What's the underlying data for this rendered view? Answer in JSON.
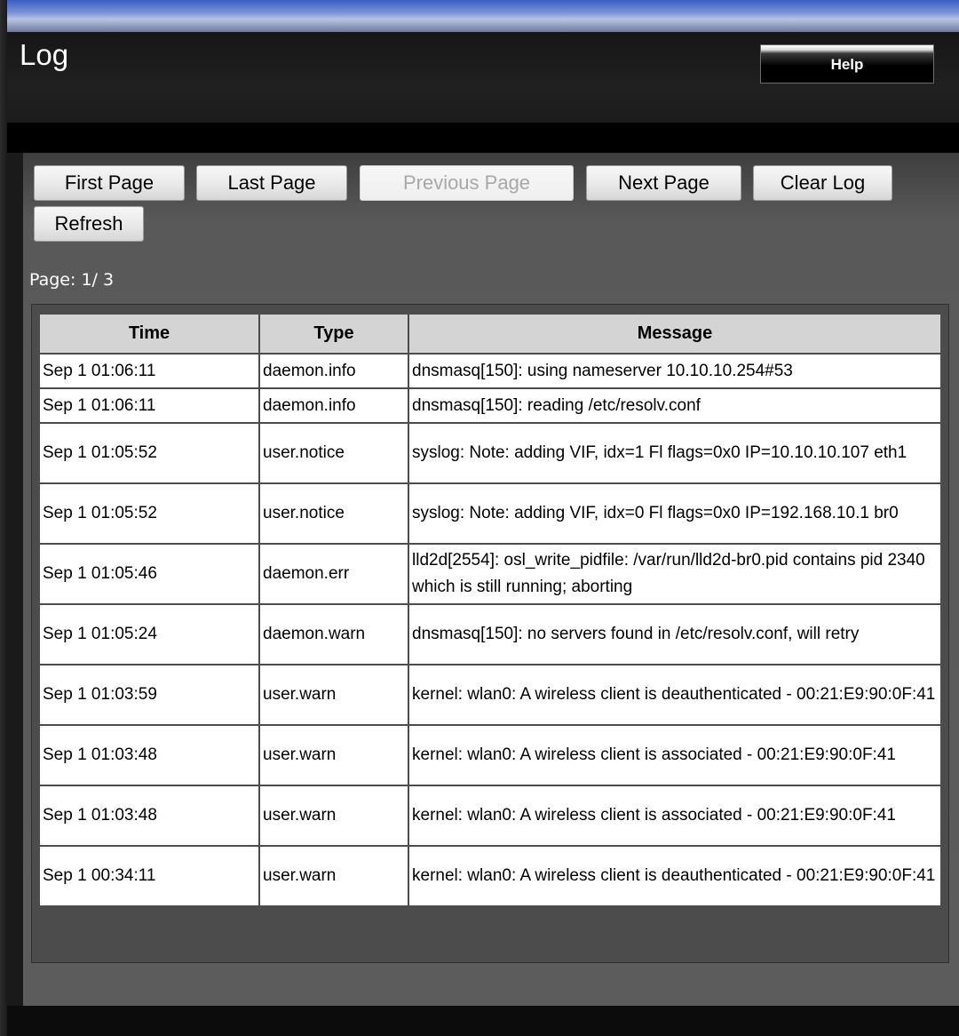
{
  "header": {
    "title": "Log",
    "help_label": "Help"
  },
  "toolbar": {
    "first_page": "First Page",
    "last_page": "Last Page",
    "previous_page": "Previous Page",
    "next_page": "Next Page",
    "clear_log": "Clear Log",
    "refresh": "Refresh"
  },
  "pagination": {
    "label": "Page: 1/ 3",
    "current": 1,
    "total": 3
  },
  "table": {
    "columns": [
      "Time",
      "Type",
      "Message"
    ],
    "rows": [
      {
        "time": "Sep 1 01:06:11",
        "type": "daemon.info",
        "message": "dnsmasq[150]: using nameserver 10.10.10.254#53"
      },
      {
        "time": "Sep 1 01:06:11",
        "type": "daemon.info",
        "message": "dnsmasq[150]: reading /etc/resolv.conf"
      },
      {
        "time": "Sep 1 01:05:52",
        "type": "user.notice",
        "message": "syslog: Note: adding VIF, idx=1 Fl flags=0x0 IP=10.10.10.107 eth1"
      },
      {
        "time": "Sep 1 01:05:52",
        "type": "user.notice",
        "message": "syslog: Note: adding VIF, idx=0 Fl flags=0x0 IP=192.168.10.1 br0"
      },
      {
        "time": "Sep 1 01:05:46",
        "type": "daemon.err",
        "message": "lld2d[2554]: osl_write_pidfile: /var/run/lld2d-br0.pid contains pid 2340 which is still running; aborting"
      },
      {
        "time": "Sep 1 01:05:24",
        "type": "daemon.warn",
        "message": "dnsmasq[150]: no servers found in /etc/resolv.conf, will retry"
      },
      {
        "time": "Sep 1 01:03:59",
        "type": "user.warn",
        "message": "kernel: wlan0: A wireless client is deauthenticated - 00:21:E9:90:0F:41"
      },
      {
        "time": "Sep 1 01:03:48",
        "type": "user.warn",
        "message": "kernel: wlan0: A wireless client is associated - 00:21:E9:90:0F:41"
      },
      {
        "time": "Sep 1 01:03:48",
        "type": "user.warn",
        "message": "kernel: wlan0: A wireless client is associated - 00:21:E9:90:0F:41"
      },
      {
        "time": "Sep 1 00:34:11",
        "type": "user.warn",
        "message": "kernel: wlan0: A wireless client is deauthenticated - 00:21:E9:90:0F:41"
      }
    ]
  }
}
